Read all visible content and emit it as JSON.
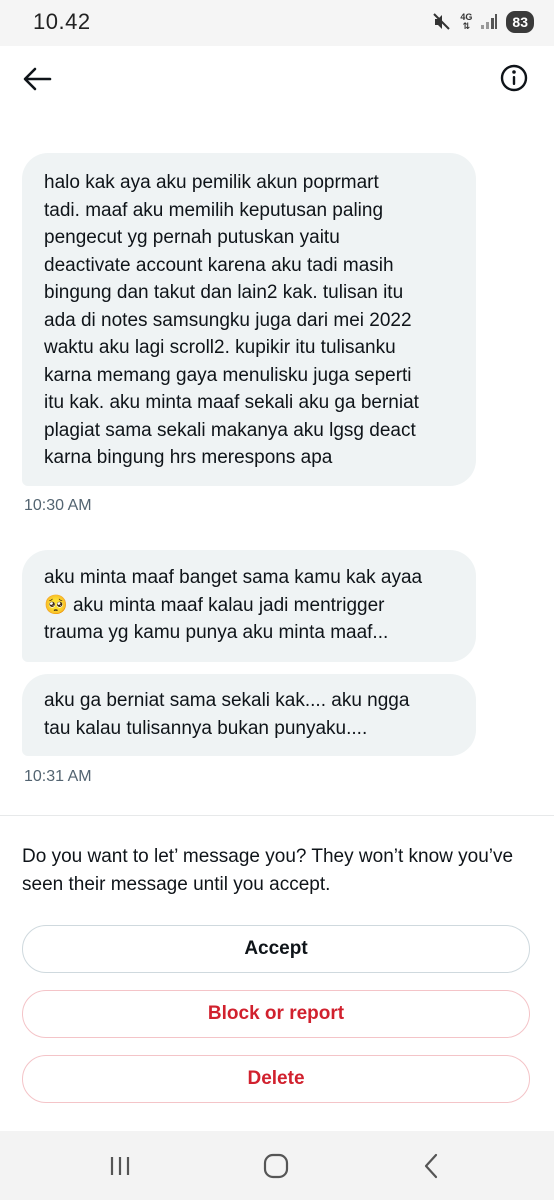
{
  "status_bar": {
    "time": "10.42",
    "network": "4G",
    "battery": "83"
  },
  "header": {
    "back_icon": "arrow-left-icon",
    "info_icon": "info-circle-icon"
  },
  "messages": [
    {
      "text": "halo kak aya aku pemilik akun poprmart\ntadi. maaf aku memilih keputusan paling\npengecut yg pernah putuskan yaitu\ndeactivate account karena aku tadi masih\nbingung dan takut dan lain2 kak. tulisan itu\nada di notes samsungku juga dari mei 2022\nwaktu aku lagi scroll2. kupikir itu tulisanku\nkarna memang gaya menulisku juga seperti\nitu kak. aku minta maaf sekali aku ga berniat\nplagiat sama sekali makanya aku lgsg deact\nkarna bingung hrs merespons apa"
    },
    {
      "text_before_emoji": "aku minta maaf banget sama kamu kak ayaa",
      "emoji": "🥺",
      "text_after_emoji": " aku minta maaf kalau jadi mentrigger\ntrauma yg kamu punya aku minta maaf..."
    },
    {
      "text": "aku ga berniat sama sekali kak.... aku ngga\ntau kalau tulisannya bukan punyaku...."
    }
  ],
  "timestamps": [
    "10:30 AM",
    "10:31 AM"
  ],
  "request": {
    "prompt": "Do you want to let’ message you? They won’t know you’ve seen their message until you accept.",
    "accept_label": "Accept",
    "block_label": "Block or report",
    "delete_label": "Delete"
  },
  "colors": {
    "bubble": "#eff3f4",
    "danger": "#d1212e",
    "muted": "#536471"
  },
  "nav": {
    "recent_icon": "recent-apps-icon",
    "home_icon": "home-icon",
    "back_icon": "nav-back-icon"
  }
}
